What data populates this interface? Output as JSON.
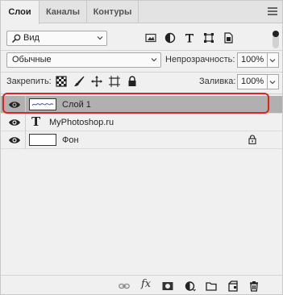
{
  "tabs": [
    {
      "label": "Слои",
      "active": true
    },
    {
      "label": "Каналы",
      "active": false
    },
    {
      "label": "Контуры",
      "active": false
    }
  ],
  "filter": {
    "kind_label": "Вид",
    "icons": [
      "image-filter-icon",
      "adjustment-filter-icon",
      "type-filter-icon",
      "shape-filter-icon",
      "smart-object-filter-icon"
    ],
    "toggle_on": true
  },
  "blend": {
    "mode": "Обычные",
    "opacity_label": "Непрозрачность:",
    "opacity_value": "100%"
  },
  "lock": {
    "label": "Закрепить:",
    "icons": [
      "lock-transparent-pixels-icon",
      "lock-image-pixels-icon",
      "lock-position-icon",
      "lock-artboard-icon",
      "lock-all-icon"
    ],
    "fill_label": "Заливка:",
    "fill_value": "100%"
  },
  "layers": [
    {
      "name": "Слой 1",
      "type": "raster",
      "selected": true,
      "visible": true,
      "locked": false
    },
    {
      "name": "MyPhotoshop.ru",
      "type": "text",
      "selected": false,
      "visible": true,
      "locked": false
    },
    {
      "name": "Фон",
      "type": "background",
      "selected": false,
      "visible": true,
      "locked": true
    }
  ],
  "type_glyph": "T",
  "bottom_toolbar": {
    "fx_label": "fx",
    "icons": [
      "link-layers-icon",
      "layer-style-icon",
      "add-mask-icon",
      "new-adjustment-layer-icon",
      "new-group-icon",
      "new-layer-icon",
      "delete-layer-icon"
    ]
  },
  "colors": {
    "selection_highlight": "#e0231c",
    "selected_row": "#b0b0b0",
    "panel_bg": "#f0f0f0"
  }
}
